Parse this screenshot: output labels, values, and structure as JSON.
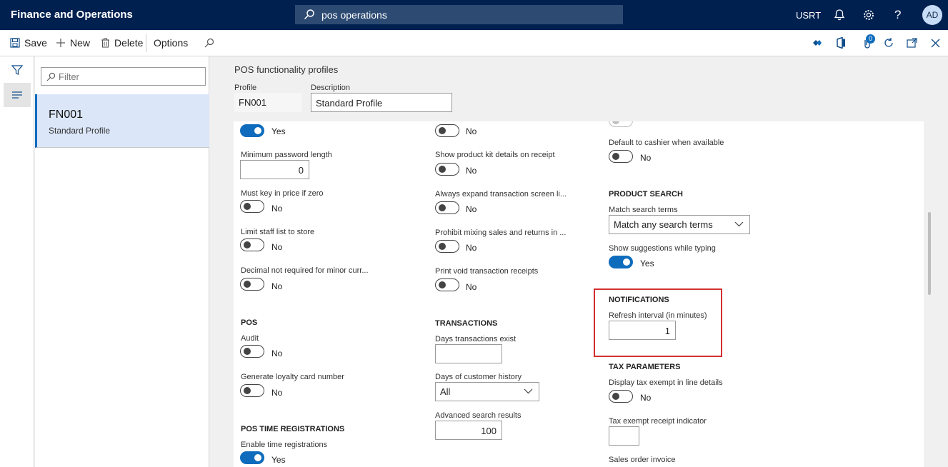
{
  "app": {
    "title": "Finance and Operations",
    "company": "USRT",
    "avatar_initials": "AD"
  },
  "search": {
    "value": "pos operations"
  },
  "toolbar": {
    "save": "Save",
    "new": "New",
    "delete": "Delete",
    "options": "Options",
    "badge_count": "0"
  },
  "list": {
    "filter_placeholder": "Filter",
    "items": [
      {
        "id": "FN001",
        "description": "Standard Profile"
      }
    ]
  },
  "page": {
    "caption": "POS functionality profiles",
    "profile_label": "Profile",
    "profile_value": "FN001",
    "description_label": "Description",
    "description_value": "Standard Profile"
  },
  "col1": {
    "top_toggle": "Yes",
    "min_password_label": "Minimum password length",
    "min_password_value": "0",
    "key_in_price_label": "Must key in price if zero",
    "key_in_price_value": "No",
    "limit_staff_label": "Limit staff list to store",
    "limit_staff_value": "No",
    "decimal_label": "Decimal not required for minor curr...",
    "decimal_value": "No",
    "pos_section": "POS",
    "audit_label": "Audit",
    "audit_value": "No",
    "loyalty_label": "Generate loyalty card number",
    "loyalty_value": "No",
    "time_section": "POS TIME REGISTRATIONS",
    "enable_time_label": "Enable time registrations",
    "enable_time_value": "Yes"
  },
  "col2": {
    "top_toggle": "No",
    "kit_label": "Show product kit details on receipt",
    "kit_value": "No",
    "expand_label": "Always expand transaction screen li...",
    "expand_value": "No",
    "mixing_label": "Prohibit mixing sales and returns in ...",
    "mixing_value": "No",
    "void_label": "Print void transaction receipts",
    "void_value": "No",
    "transactions_section": "TRANSACTIONS",
    "days_exist_label": "Days transactions exist",
    "days_exist_value": "",
    "history_label": "Days of customer history",
    "history_value": "All",
    "advanced_label": "Advanced search results",
    "advanced_value": "100"
  },
  "col3": {
    "cashier_label": "Default to cashier when available",
    "cashier_value": "No",
    "product_search_section": "PRODUCT SEARCH",
    "match_label": "Match search terms",
    "match_value": "Match any search terms",
    "suggestions_label": "Show suggestions while typing",
    "suggestions_value": "Yes",
    "notifications_section": "NOTIFICATIONS",
    "refresh_label": "Refresh interval (in minutes)",
    "refresh_value": "1",
    "tax_section": "TAX PARAMETERS",
    "tax_exempt_label": "Display tax exempt in line details",
    "tax_exempt_value": "No",
    "tax_indicator_label": "Tax exempt receipt indicator",
    "tax_indicator_value": "",
    "sales_order_label": "Sales order invoice"
  }
}
